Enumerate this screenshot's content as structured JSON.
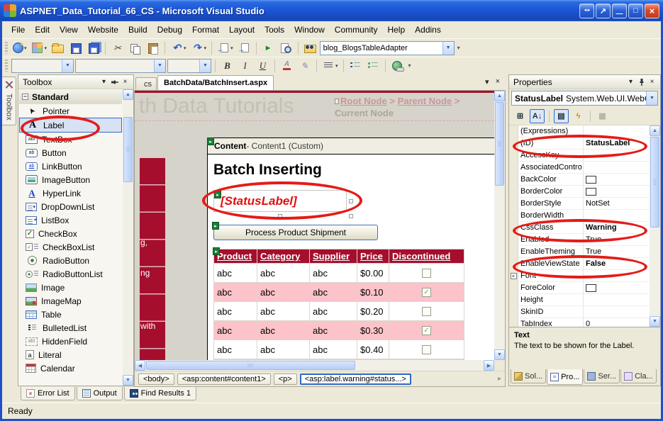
{
  "colors": {
    "crimson": "#a50e2d",
    "pink_row": "#fcc3ca",
    "annotation_red": "#e41b17",
    "selection_blue": "#316ac5",
    "xp_titlebar_blue": "#1c57d6",
    "panel_beige": "#ece9d8"
  },
  "window": {
    "title": "ASPNET_Data_Tutorial_66_CS - Microsoft Visual Studio",
    "controls": [
      {
        "icon": "resize-arrows-icon",
        "name": "resize-arrows"
      },
      {
        "icon": "pop-out-icon",
        "name": "pop-out"
      },
      {
        "icon": "minimize-icon",
        "name": "minimize"
      },
      {
        "icon": "maximize-icon",
        "name": "maximize"
      },
      {
        "icon": "close-icon",
        "name": "close"
      }
    ]
  },
  "menu": {
    "items": [
      "File",
      "Edit",
      "View",
      "Website",
      "Build",
      "Debug",
      "Format",
      "Layout",
      "Tools",
      "Window",
      "Community",
      "Help",
      "Addins"
    ]
  },
  "toolbar_standard": {
    "buttons": [
      {
        "icon": "new-website-icon",
        "dropdown": true
      },
      {
        "icon": "add-item-icon",
        "dropdown": true
      },
      {
        "icon": "open-icon"
      },
      {
        "icon": "save-icon"
      },
      {
        "icon": "save-all-icon"
      },
      {
        "icon": "cut-icon"
      },
      {
        "icon": "copy-icon"
      },
      {
        "icon": "paste-icon"
      },
      {
        "icon": "undo-icon",
        "dropdown": true
      },
      {
        "icon": "redo-icon",
        "dropdown": true
      },
      {
        "icon": "nav-back-icon",
        "dropdown": true
      },
      {
        "icon": "nav-forward-icon"
      },
      {
        "icon": "start-debug-icon"
      },
      {
        "icon": "view-in-browser-icon"
      },
      {
        "icon": "find-in-files-icon"
      }
    ],
    "combo_value": "blog_BlogsTableAdapter"
  },
  "toolbar_format": {
    "buttons": [
      {
        "icon": "bold-icon"
      },
      {
        "icon": "italic-icon"
      },
      {
        "icon": "underline-icon"
      },
      {
        "icon": "fore-color-icon"
      },
      {
        "icon": "highlight-icon"
      },
      {
        "icon": "align-icon",
        "dropdown": true
      },
      {
        "icon": "bullets-icon"
      },
      {
        "icon": "numbering-icon"
      },
      {
        "icon": "hyperlink-icon"
      }
    ]
  },
  "toolbox": {
    "tab_label": "Toolbox",
    "title": "Toolbox",
    "section": "Standard",
    "items": [
      {
        "label": "Pointer",
        "icon": "pointer-icon"
      },
      {
        "label": "Label",
        "icon": "label-icon",
        "selected": true,
        "circled": true
      },
      {
        "label": "TextBox",
        "icon": "textbox-icon"
      },
      {
        "label": "Button",
        "icon": "button-icon"
      },
      {
        "label": "LinkButton",
        "icon": "linkbutton-icon"
      },
      {
        "label": "ImageButton",
        "icon": "imagebutton-icon"
      },
      {
        "label": "HyperLink",
        "icon": "hyperlink-a-icon"
      },
      {
        "label": "DropDownList",
        "icon": "dropdownlist-icon"
      },
      {
        "label": "ListBox",
        "icon": "listbox-icon"
      },
      {
        "label": "CheckBox",
        "icon": "checkbox-icon"
      },
      {
        "label": "CheckBoxList",
        "icon": "checkboxlist-icon"
      },
      {
        "label": "RadioButton",
        "icon": "radiobutton-icon"
      },
      {
        "label": "RadioButtonList",
        "icon": "radiobuttonlist-icon"
      },
      {
        "label": "Image",
        "icon": "image-icon"
      },
      {
        "label": "ImageMap",
        "icon": "imagemap-icon"
      },
      {
        "label": "Table",
        "icon": "table-icon"
      },
      {
        "label": "BulletedList",
        "icon": "bulletedlist-icon"
      },
      {
        "label": "HiddenField",
        "icon": "hiddenfield-icon"
      },
      {
        "label": "Literal",
        "icon": "literal-icon"
      },
      {
        "label": "Calendar",
        "icon": "calendar-icon"
      }
    ]
  },
  "editor": {
    "tabs": {
      "partial": "cs",
      "active": "BatchData/BatchInsert.aspx"
    },
    "page": {
      "banner_title": "th Data Tutorials",
      "breadcrumb": {
        "root": "Root Node",
        "parent": "Parent Node",
        "current": "Current Node",
        "separator": ">"
      },
      "sidebar_fragments": [
        {
          "text": "g,"
        },
        {
          "text": "ng"
        },
        {
          "text": "with"
        }
      ],
      "content_region": {
        "title_bold": "Content",
        "title_rest": " - Content1 (Custom)"
      },
      "heading": "Batch Inserting",
      "status_label": "[StatusLabel]",
      "button_label": "Process Product Shipment",
      "grid": {
        "columns": [
          "Product",
          "Category",
          "Supplier",
          "Price",
          "Discontinued"
        ],
        "rows": [
          {
            "cells": [
              "abc",
              "abc",
              "abc",
              "$0.00"
            ],
            "discontinued": false,
            "shaded": false
          },
          {
            "cells": [
              "abc",
              "abc",
              "abc",
              "$0.10"
            ],
            "discontinued": true,
            "shaded": true
          },
          {
            "cells": [
              "abc",
              "abc",
              "abc",
              "$0.20"
            ],
            "discontinued": false,
            "shaded": false
          },
          {
            "cells": [
              "abc",
              "abc",
              "abc",
              "$0.30"
            ],
            "discontinued": true,
            "shaded": true
          },
          {
            "cells": [
              "abc",
              "abc",
              "abc",
              "$0.40"
            ],
            "discontinued": false,
            "shaded": false
          }
        ],
        "partial_row_shaded": true
      }
    },
    "tag_path": [
      {
        "label": "<body>"
      },
      {
        "label": "<asp:content#content1>"
      },
      {
        "label": "<p>"
      },
      {
        "label": "<asp:label.warning#status...>",
        "selected": true
      }
    ]
  },
  "properties": {
    "title": "Properties",
    "object_name": "StatusLabel",
    "object_type": "System.Web.UI.WebCor",
    "toolbar_icons": [
      {
        "icon": "categorized-icon"
      },
      {
        "icon": "alphabetical-icon",
        "selected": true
      },
      {
        "icon": "properties-list-icon",
        "selected": true
      },
      {
        "icon": "events-icon"
      },
      {
        "icon": "property-pages-icon",
        "disabled": true
      }
    ],
    "rows": [
      {
        "name": "(Expressions)",
        "value": ""
      },
      {
        "name": "(ID)",
        "value": "StatusLabel",
        "bold": true,
        "circled": true
      },
      {
        "name": "AccessKey",
        "value": ""
      },
      {
        "name": "AssociatedContro",
        "value": ""
      },
      {
        "name": "BackColor",
        "value": "",
        "swatch": true
      },
      {
        "name": "BorderColor",
        "value": "",
        "swatch": true
      },
      {
        "name": "BorderStyle",
        "value": "NotSet"
      },
      {
        "name": "BorderWidth",
        "value": ""
      },
      {
        "name": "CssClass",
        "value": "Warning",
        "bold": true,
        "circled": true
      },
      {
        "name": "Enabled",
        "value": "True"
      },
      {
        "name": "EnableTheming",
        "value": "True"
      },
      {
        "name": "EnableViewState",
        "value": "False",
        "bold": true,
        "circled": true
      },
      {
        "name": "Font",
        "value": "",
        "expandable": true
      },
      {
        "name": "ForeColor",
        "value": "",
        "swatch": true
      },
      {
        "name": "Height",
        "value": ""
      },
      {
        "name": "SkinID",
        "value": ""
      },
      {
        "name": "TabIndex",
        "value": "0"
      }
    ],
    "description": {
      "title": "Text",
      "body": "The text to be shown for the Label."
    },
    "tabs": [
      {
        "label": "Sol...",
        "icon": "solution-explorer-icon"
      },
      {
        "label": "Pro...",
        "icon": "properties-icon",
        "active": true
      },
      {
        "label": "Ser...",
        "icon": "server-explorer-icon"
      },
      {
        "label": "Cla...",
        "icon": "class-view-icon"
      }
    ]
  },
  "bottom": {
    "tabs": [
      {
        "label": "Error List",
        "icon": "error-list-icon"
      },
      {
        "label": "Output",
        "icon": "output-icon"
      },
      {
        "label": "Find Results 1",
        "icon": "find-results-icon"
      }
    ],
    "status": "Ready"
  }
}
